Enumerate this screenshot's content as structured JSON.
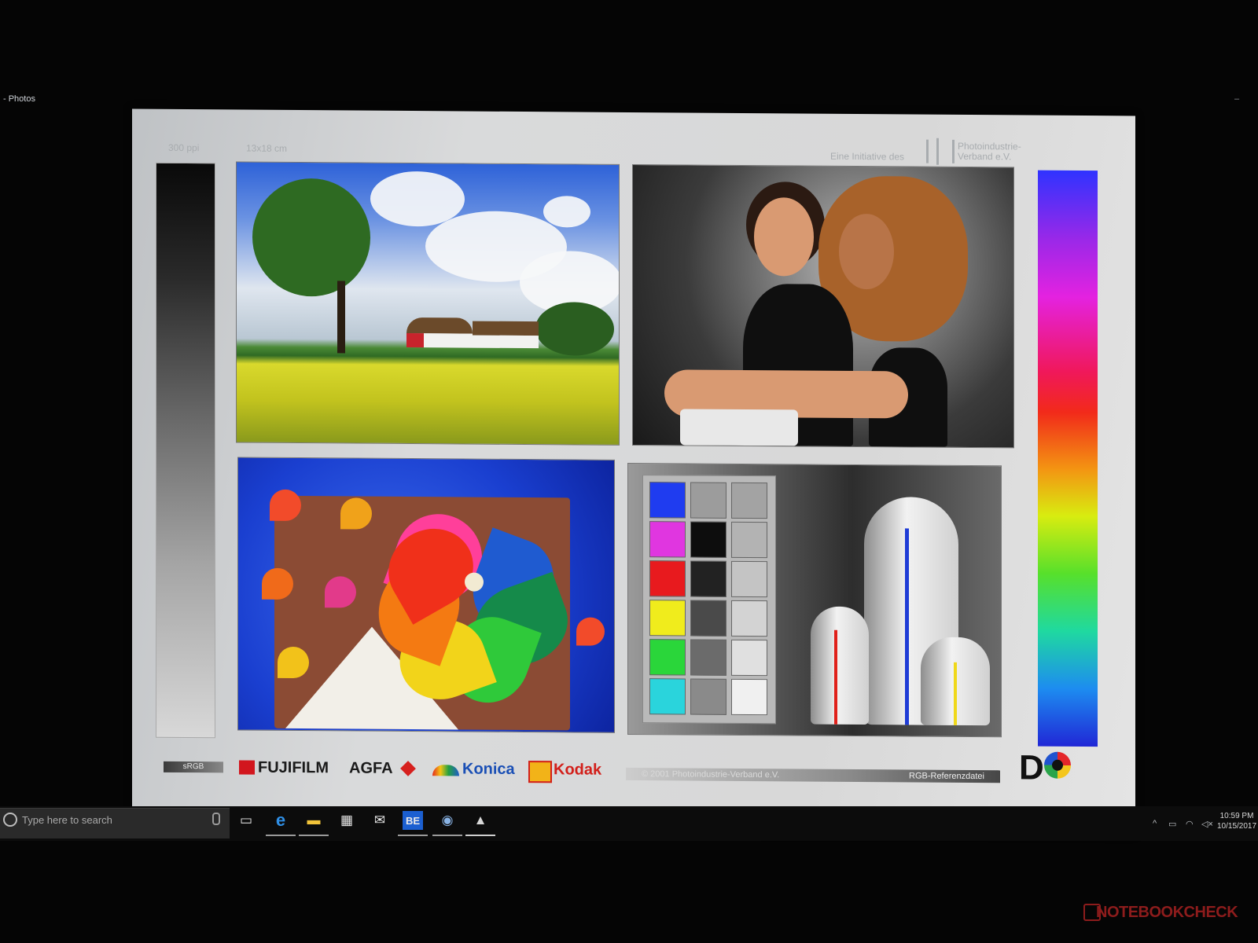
{
  "window": {
    "title": "- Photos",
    "minimize_glyph": "–"
  },
  "test_chart": {
    "resolution": "300 ppi",
    "print_size": "13x18 cm",
    "initiative_text": "Eine Initiative des",
    "association_name": "Photoindustrie-\nVerband e.V.",
    "colorspace_label": "sRGB",
    "brands": [
      "FUJIFILM",
      "AGFA",
      "Konica",
      "Kodak"
    ],
    "agfa_mark": "Agfa",
    "copyright": "© 2001 Photoindustrie-Verband e.V.",
    "file_label": "RGB-Referenzdatei",
    "logo_text": "D",
    "photos": [
      "landscape",
      "portrait",
      "pinwheels",
      "color-patches-and-vases"
    ],
    "patch_colors": [
      [
        "#1f3cf0",
        "#9c9c9c",
        "#a3a3a3"
      ],
      [
        "#e036e0",
        "#0d0d0d",
        "#b3b3b3"
      ],
      [
        "#e81a1e",
        "#222222",
        "#c4c4c4"
      ],
      [
        "#f0ec1c",
        "#4a4a4a",
        "#d3d3d3"
      ],
      [
        "#2ad63a",
        "#6b6b6b",
        "#e0e0e0"
      ],
      [
        "#2ad4dc",
        "#8a8a8a",
        "#f0f0f0"
      ]
    ]
  },
  "taskbar": {
    "search_placeholder": "Type here to search",
    "apps": [
      {
        "icon": "task-view-icon",
        "glyph": "▭"
      },
      {
        "icon": "edge-icon",
        "glyph": "e"
      },
      {
        "icon": "file-explorer-icon",
        "glyph": "▬"
      },
      {
        "icon": "store-icon",
        "glyph": "▦"
      },
      {
        "icon": "mail-icon",
        "glyph": "✉"
      },
      {
        "icon": "be-icon",
        "glyph": "BE"
      },
      {
        "icon": "steam-icon",
        "glyph": "◉"
      },
      {
        "icon": "photos-icon",
        "glyph": "▲"
      }
    ],
    "tray": {
      "chevron": "^",
      "battery_glyph": "▭",
      "wifi_glyph": "◠",
      "volume_glyph": "◁×"
    },
    "time": "10:59 PM",
    "date": "10/15/2017"
  },
  "watermark": "NOTEBOOKCHECK",
  "colors": {
    "background": "#050505",
    "sheet": "#d8d8d8",
    "taskbar": "#0c0c0c",
    "kodak_red": "#d21f1a",
    "konica_blue": "#1a4fb5",
    "fuji_red": "#d2161e"
  }
}
